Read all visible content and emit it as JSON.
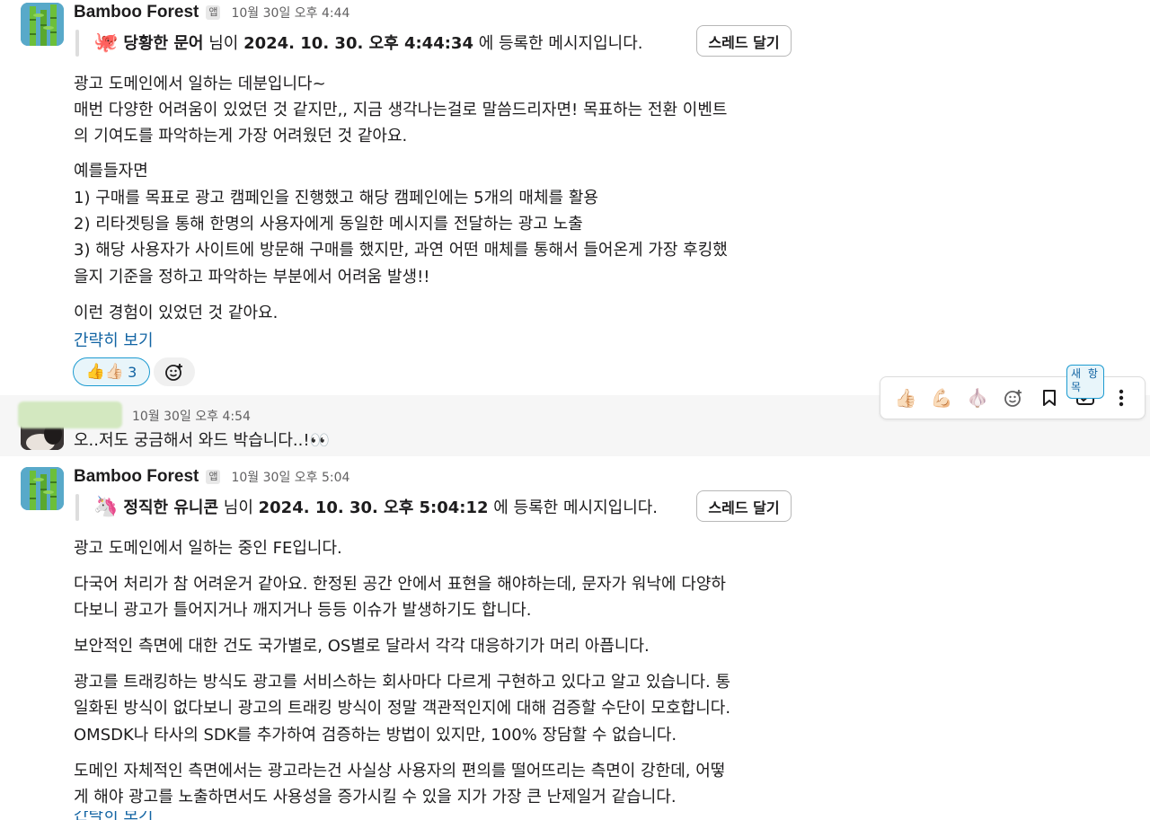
{
  "msg1": {
    "sender": "Bamboo Forest",
    "badge": "앱",
    "time": "10월 30일 오후 4:44",
    "reg_emoji": "🐙",
    "reg_nick": "당황한 문어",
    "reg_mid": " 님이 ",
    "reg_date": "2024. 10. 30. 오후 4:44:34",
    "reg_tail": " 에 등록한 메시지입니다.",
    "thread_label": "스레드 달기",
    "paragraphs": [
      "광고 도메인에서 일하는 데분입니다~",
      "매번 다양한 어려움이 있었던 것 같지만,, 지금 생각나는걸로 말씀드리자면! 목표하는 전환 이벤트",
      "의 기여도를 파악하는게 가장 어려웠던 것 같아요.",
      "예를들자면",
      "1) 구매를 목표로 광고 캠페인을 진행했고 해당 캠페인에는 5개의 매체를 활용",
      "2) 리타겟팅을 통해 한명의 사용자에게 동일한 메시지를 전달하는 광고 노출",
      "3) 해당 사용자가 사이트에 방문해 구매를 했지만, 과연 어떤 매체를 통해서 들어온게 가장 후킹했",
      "을지 기준을 정하고 파악하는 부분에서 어려움 발생!!",
      "이런 경험이 있었던 것 같아요."
    ],
    "collapse_link": "간략히 보기",
    "reaction_emojis": "👍👍🏻",
    "reaction_count": "3"
  },
  "msg2": {
    "time": "10월 30일 오후 4:54",
    "text": "오..저도 궁금해서 와드 박습니다..!👀"
  },
  "toolbar": {
    "tooltip": "새 항목",
    "icons": [
      "thumbs-up-icon",
      "flexed-biceps-icon",
      "garlic-icon",
      "add-reaction-icon",
      "bookmark-icon",
      "new-item-icon",
      "more-icon"
    ]
  },
  "msg3": {
    "sender": "Bamboo Forest",
    "badge": "앱",
    "time": "10월 30일 오후 5:04",
    "reg_emoji": "🦄",
    "reg_nick": "정직한 유니콘",
    "reg_mid": " 님이 ",
    "reg_date": "2024. 10. 30. 오후 5:04:12",
    "reg_tail": " 에 등록한 메시지입니다.",
    "thread_label": "스레드 달기",
    "paragraphs": [
      "광고 도메인에서 일하는 중인 FE입니다.",
      "다국어 처리가 참 어려운거 같아요. 한정된 공간 안에서 표현을 해야하는데, 문자가 워낙에 다양하",
      "다보니 광고가 틀어지거나 깨지거나 등등 이슈가 발생하기도 합니다.",
      "보안적인 측면에 대한 건도 국가별로, OS별로 달라서 각각 대응하기가 머리 아픕니다.",
      "광고를 트래킹하는 방식도 광고를 서비스하는 회사마다 다르게 구현하고 있다고 알고 있습니다. 통",
      "일화된 방식이 없다보니 광고의 트래킹 방식이 정말 객관적인지에 대해 검증할 수단이 모호합니다.",
      "OMSDK나 타사의 SDK를 추가하여 검증하는 방법이 있지만, 100% 장담할 수 없습니다.",
      "도메인 자체적인 측면에서는 광고라는건 사실상 사용자의 편의를 떨어뜨리는 측면이 강한데, 어떻",
      "게 해야 광고를 노출하면서도 사용성을 증가시킬 수 있을 지가 가장 큰 난제일거 같습니다."
    ],
    "collapse_link": "간략히 보기"
  }
}
